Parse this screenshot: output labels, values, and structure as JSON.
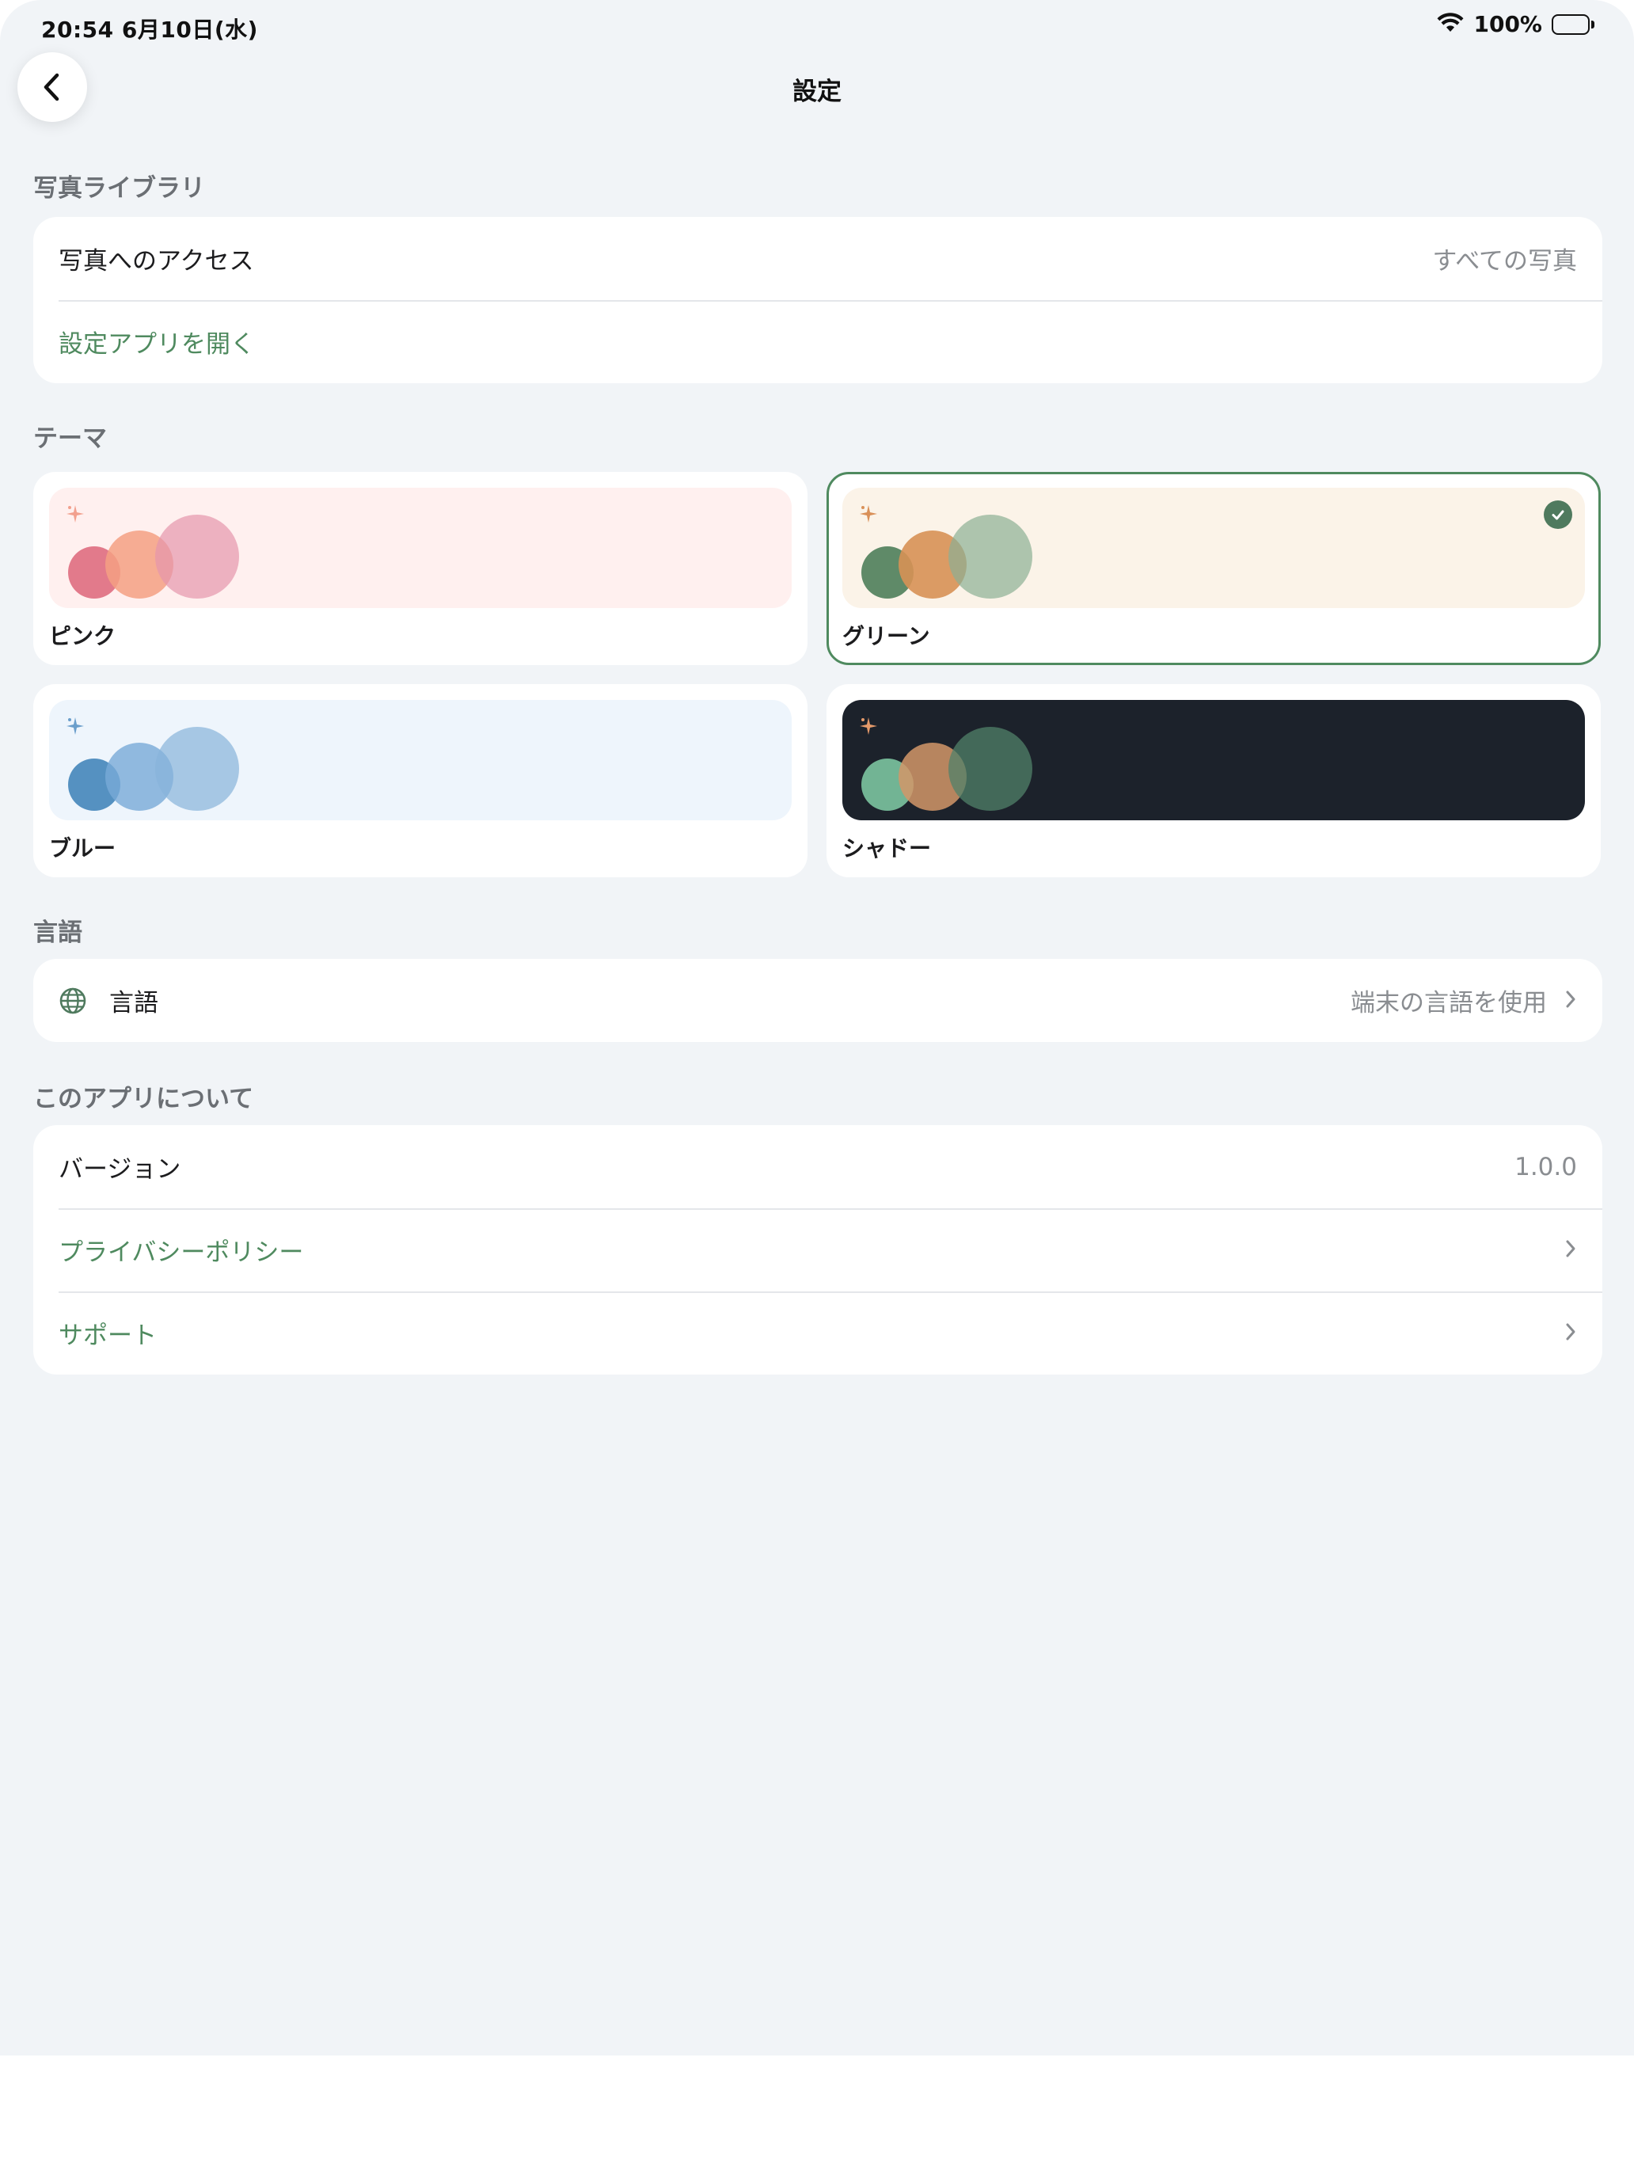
{
  "status_bar": {
    "time_date": "20:54   6月10日(水)",
    "battery_pct": "100%",
    "battery_level": 1.0
  },
  "nav": {
    "title": "設定",
    "back_icon": "chevron-left-icon"
  },
  "sections": {
    "photo_library": {
      "header": "写真ライブラリ",
      "access_label": "写真へのアクセス",
      "access_value": "すべての写真",
      "open_settings": "設定アプリを開く"
    },
    "theme": {
      "header": "テーマ",
      "options": [
        {
          "name": "ピンク",
          "selected": false,
          "bg": "#fff0ef",
          "sparkle": "#f2a08e",
          "circles": [
            "#e27a8b",
            "#f6ab8f",
            "#eeb0be"
          ]
        },
        {
          "name": "グリーン",
          "selected": true,
          "bg": "#fbf3e8",
          "sparkle": "#d99058",
          "circles": [
            "#5f8a68",
            "#d99a63",
            "#adc5b0"
          ]
        },
        {
          "name": "ブルー",
          "selected": false,
          "bg": "#eef5fc",
          "sparkle": "#6a9ecb",
          "circles": [
            "#5591c1",
            "#8fb7dc",
            "#a3c4e0"
          ]
        },
        {
          "name": "シャドー",
          "selected": false,
          "bg": "#1c222b",
          "sparkle": "#e59a6a",
          "circles": [
            "#72b494",
            "#c79168",
            "#3f6654"
          ]
        }
      ]
    },
    "language": {
      "header": "言語",
      "label": "言語",
      "value": "端末の言語を使用",
      "icon": "globe-icon"
    },
    "about": {
      "header": "このアプリについて",
      "version_label": "バージョン",
      "version_value": "1.0.0",
      "privacy": "プライバシーポリシー",
      "support": "サポート"
    }
  },
  "colors": {
    "accent_green": "#4f8a5f",
    "background": "#f1f4f7",
    "card": "#ffffff",
    "secondary_text": "#8a8d91"
  }
}
